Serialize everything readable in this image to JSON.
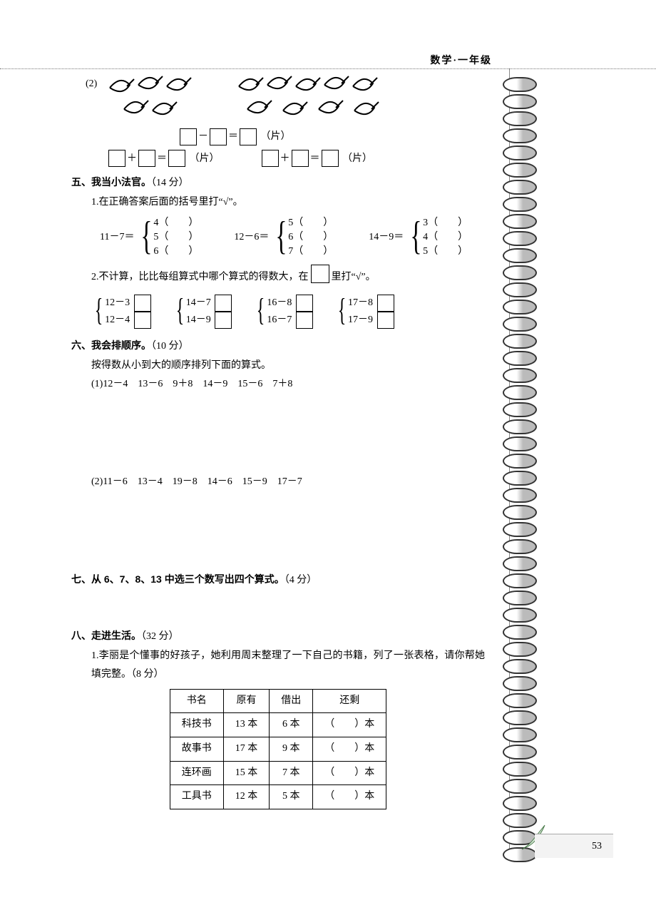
{
  "header": "数学·一年级",
  "page_number": "53",
  "q2": {
    "label": "(2)",
    "minus_suffix": "（片）",
    "plus_suffix": "（片）"
  },
  "s5": {
    "title": "五、我当小法官。",
    "points": "（14 分）",
    "sub1": "1.在正确答案后面的括号里打“√”。",
    "groups": [
      {
        "lhs": "11－7＝",
        "rows": [
          "4（　　）",
          "5（　　）",
          "6（　　）"
        ]
      },
      {
        "lhs": "12－6＝",
        "rows": [
          "5（　　）",
          "6（　　）",
          "7（　　）"
        ]
      },
      {
        "lhs": "14－9＝",
        "rows": [
          "3（　　）",
          "4（　　）",
          "5（　　）"
        ]
      }
    ],
    "sub2_a": "2.不计算，比比每组算式中哪个算式的得数大，在",
    "sub2_b": "里打“√”。",
    "pairs": [
      [
        "12－3",
        "12－4"
      ],
      [
        "14－7",
        "14－9"
      ],
      [
        "16－8",
        "16－7"
      ],
      [
        "17－8",
        "17－9"
      ]
    ]
  },
  "s6": {
    "title": "六、我会排顺序。",
    "points": "（10 分）",
    "lead": "按得数从小到大的顺序排列下面的算式。",
    "row1": "(1)12－4　13－6　9＋8　14－9　15－6　7＋8",
    "row2": "(2)11－6　13－4　19－8　14－6　15－9　17－7"
  },
  "s7": {
    "title": "七、从 6、7、8、13 中选三个数写出四个算式。",
    "points": "（4 分）"
  },
  "s8": {
    "title": "八、走进生活。",
    "points": "（32 分）",
    "sub1": "1.李丽是个懂事的好孩子，她利用周末整理了一下自己的书籍，列了一张表格，请你帮她填完整。（8 分）",
    "table": {
      "headers": [
        "书名",
        "原有",
        "借出",
        "还剩"
      ],
      "rows": [
        [
          "科技书",
          "13 本",
          "6 本",
          "（　　）本"
        ],
        [
          "故事书",
          "17 本",
          "9 本",
          "（　　）本"
        ],
        [
          "连环画",
          "15 本",
          "7 本",
          "（　　）本"
        ],
        [
          "工具书",
          "12 本",
          "5 本",
          "（　　）本"
        ]
      ]
    }
  }
}
